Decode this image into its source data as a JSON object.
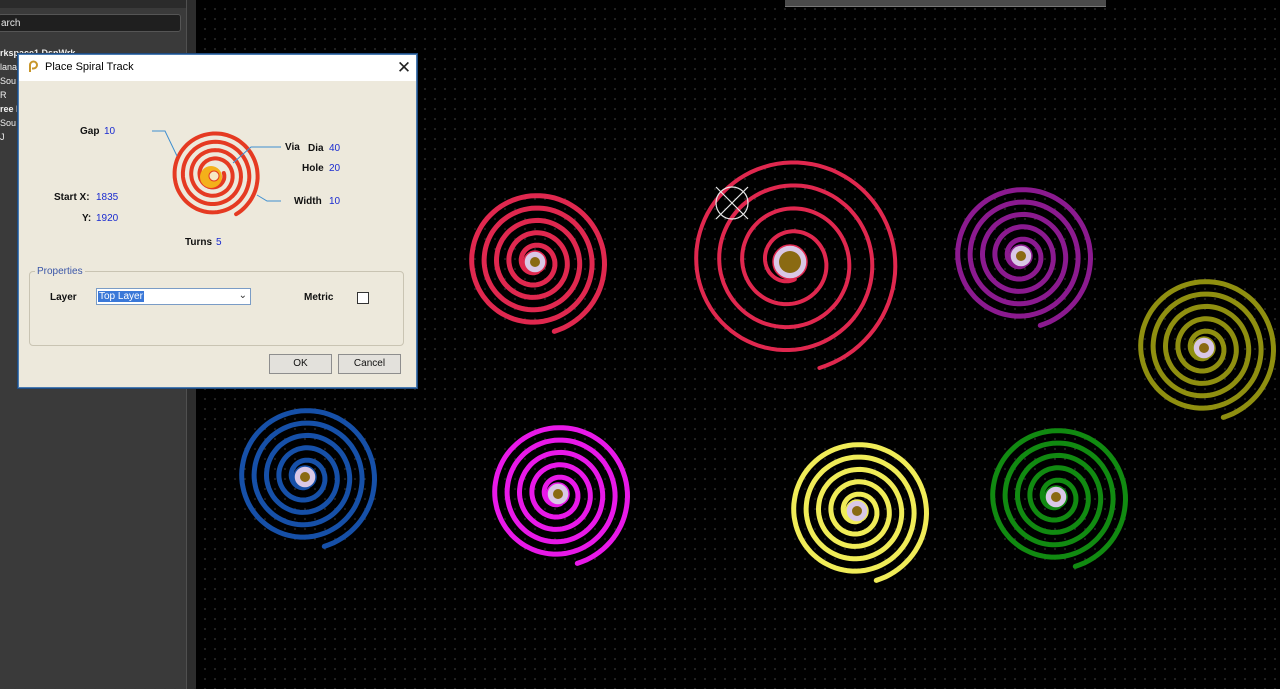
{
  "left_panel": {
    "search_text": "arch",
    "tree": [
      {
        "label": "rkspace1.DsnWrk",
        "bold": true
      },
      {
        "label": "lana",
        "bold": false
      },
      {
        "label": "Sou",
        "bold": false
      },
      {
        "label": "R",
        "bold": false
      },
      {
        "label": "ree l",
        "bold": true
      },
      {
        "label": "Sou",
        "bold": false
      },
      {
        "label": "J",
        "bold": false
      }
    ]
  },
  "dialog": {
    "title": "Place Spiral Track",
    "close_glyph": "✕",
    "gap_label": "Gap",
    "gap_value": "10",
    "via_label": "Via",
    "dia_label": "Dia",
    "dia_value": "40",
    "hole_label": "Hole",
    "hole_value": "20",
    "startx_label": "Start X:",
    "startx_value": "1835",
    "y_label": "Y:",
    "y_value": "1920",
    "width_label": "Width",
    "width_value": "10",
    "turns_label": "Turns",
    "turns_value": "5",
    "properties_label": "Properties",
    "layer_label": "Layer",
    "layer_value": "Top Layer",
    "metric_label": "Metric",
    "metric_checked": false,
    "ok_label": "OK",
    "cancel_label": "Cancel"
  },
  "canvas": {
    "spirals": [
      {
        "color": "#e0284f",
        "name": "red-spiral"
      },
      {
        "color": "#e0284f",
        "name": "large-red-spiral"
      },
      {
        "color": "#8b1a8f",
        "name": "purple-spiral"
      },
      {
        "color": "#8f8f10",
        "name": "olive-spiral"
      },
      {
        "color": "#1650a8",
        "name": "blue-spiral"
      },
      {
        "color": "#e819e8",
        "name": "magenta-spiral"
      },
      {
        "color": "#f0ec58",
        "name": "yellow-spiral"
      },
      {
        "color": "#118a11",
        "name": "green-spiral"
      }
    ],
    "via_colors": {
      "pad": "#d9c8e6",
      "hole": "#8a6a12"
    },
    "icons": [
      "crosshair-cursor-icon"
    ]
  }
}
